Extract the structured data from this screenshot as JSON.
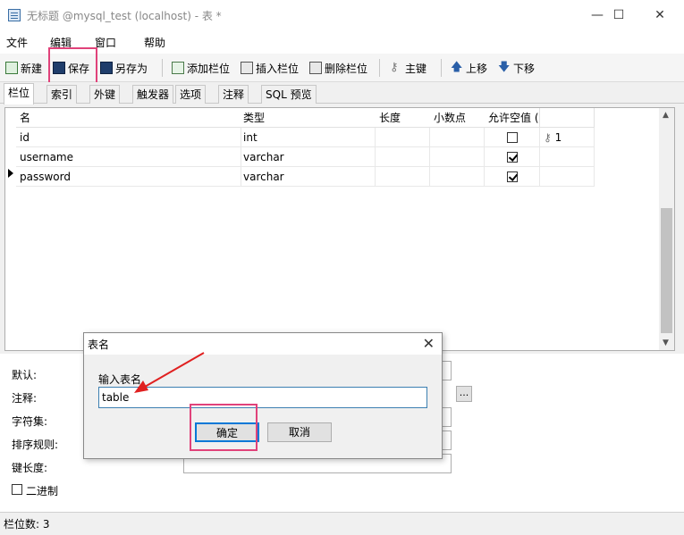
{
  "window": {
    "title": "无标题 @mysql_test (localhost) - 表 *",
    "minimize": "—",
    "maximize": "☐",
    "close": "✕"
  },
  "menu": [
    "文件",
    "编辑",
    "窗口",
    "帮助"
  ],
  "toolbar": {
    "new": "新建",
    "save": "保存",
    "save_as": "另存为",
    "add_field": "添加栏位",
    "insert_field": "插入栏位",
    "delete_field": "删除栏位",
    "primary_key": "主键",
    "move_up": "上移",
    "move_down": "下移"
  },
  "tabs": [
    "栏位",
    "索引",
    "外键",
    "触发器",
    "选项",
    "注释",
    "SQL 预览"
  ],
  "grid": {
    "headers": [
      "名",
      "类型",
      "长度",
      "小数点",
      "允许空值 (",
      ""
    ],
    "rows": [
      {
        "name": "id",
        "type": "int",
        "length": "",
        "decimal": "",
        "nullable": false,
        "key": "1"
      },
      {
        "name": "username",
        "type": "varchar",
        "length": "",
        "decimal": "",
        "nullable": true,
        "key": ""
      },
      {
        "name": "password",
        "type": "varchar",
        "length": "",
        "decimal": "",
        "nullable": true,
        "key": ""
      }
    ]
  },
  "props": {
    "default": "默认:",
    "comment": "注释:",
    "charset": "字符集:",
    "collation": "排序规则:",
    "key_length": "键长度:",
    "binary": "二进制",
    "ellipsis": "..."
  },
  "dialog": {
    "title": "表名",
    "label": "输入表名",
    "value": "table",
    "ok": "确定",
    "cancel": "取消",
    "close": "✕"
  },
  "status": {
    "field_count": "栏位数: 3"
  },
  "colors": {
    "annotation": "#e0427a",
    "arrow": "#e02020",
    "focus": "#0078d7"
  }
}
